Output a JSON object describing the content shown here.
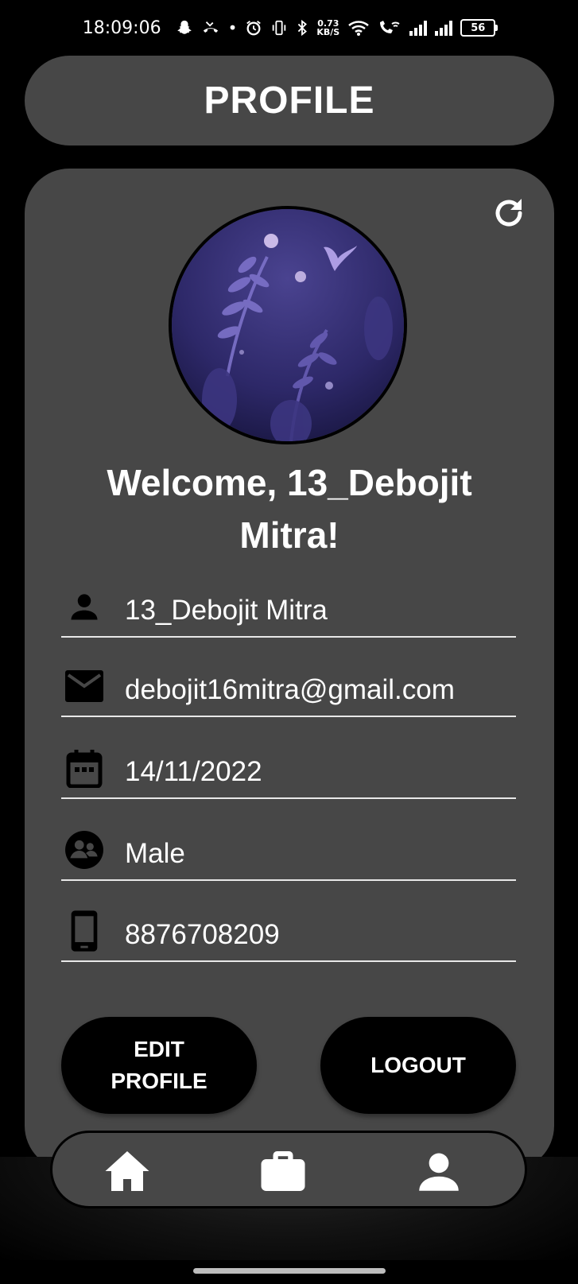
{
  "status_bar": {
    "time": "18:09:06",
    "net_speed_value": "0.73",
    "net_speed_unit": "KB/S",
    "battery": "56"
  },
  "header": {
    "title": "PROFILE"
  },
  "profile": {
    "welcome": "Welcome, 13_Debojit Mitra!",
    "fields": [
      {
        "icon": "person-icon",
        "value": "13_Debojit Mitra"
      },
      {
        "icon": "mail-icon",
        "value": "debojit16mitra@gmail.com"
      },
      {
        "icon": "calendar-icon",
        "value": "14/11/2022"
      },
      {
        "icon": "gender-icon",
        "value": "Male"
      },
      {
        "icon": "phone-icon",
        "value": "8876708209"
      }
    ]
  },
  "actions": {
    "edit_label": "EDIT\nPROFILE",
    "logout_label": "LOGOUT"
  },
  "nav": {
    "items": [
      {
        "icon": "home-icon"
      },
      {
        "icon": "briefcase-icon"
      },
      {
        "icon": "person-icon"
      }
    ]
  },
  "colors": {
    "background": "#000000",
    "surface": "#474747",
    "text": "#ffffff",
    "button": "#000000"
  }
}
